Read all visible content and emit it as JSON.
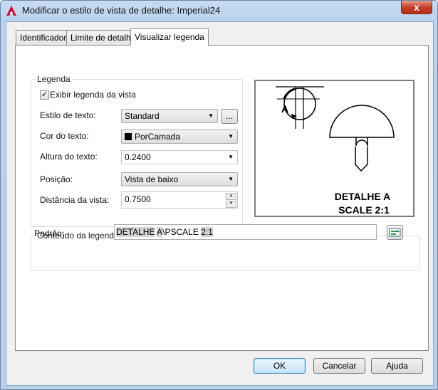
{
  "window": {
    "title": "Modificar o estilo de vista de detalhe: Imperial24",
    "close_label": "x",
    "app_icon": "autocad-a-icon"
  },
  "tabs": [
    {
      "label": "Identificador"
    },
    {
      "label": "Limite de detalhe"
    },
    {
      "label": "Visualizar legenda"
    }
  ],
  "legend_group": {
    "title": "Legenda",
    "show_label_checkbox": {
      "label": "Exibir legenda da vista",
      "checked": true
    },
    "text_style": {
      "label": "Estilo de texto:",
      "value": "Standard",
      "browse_label": "..."
    },
    "text_color": {
      "label": "Cor do texto:",
      "value": "PorCamada",
      "swatch_color": "#000000"
    },
    "text_height": {
      "label": "Altura do texto:",
      "value": "0.2400"
    },
    "position": {
      "label": "Posição:",
      "value": "Vista de baixo"
    },
    "view_distance": {
      "label": "Distância da vista:",
      "value": "0.7500"
    }
  },
  "preview": {
    "marker_letter": "A",
    "caption_line1": "DETALHE A",
    "caption_line2": "SCALE 2:1"
  },
  "content_group": {
    "title": "Conteúdo da legenda",
    "pattern_label": "Padrão:",
    "pattern_parts": [
      "DETALHE",
      " ",
      "A",
      "\\PSCALE ",
      "2:1"
    ]
  },
  "buttons": {
    "ok": "OK",
    "cancel": "Cancelar",
    "help": "Ajuda"
  }
}
